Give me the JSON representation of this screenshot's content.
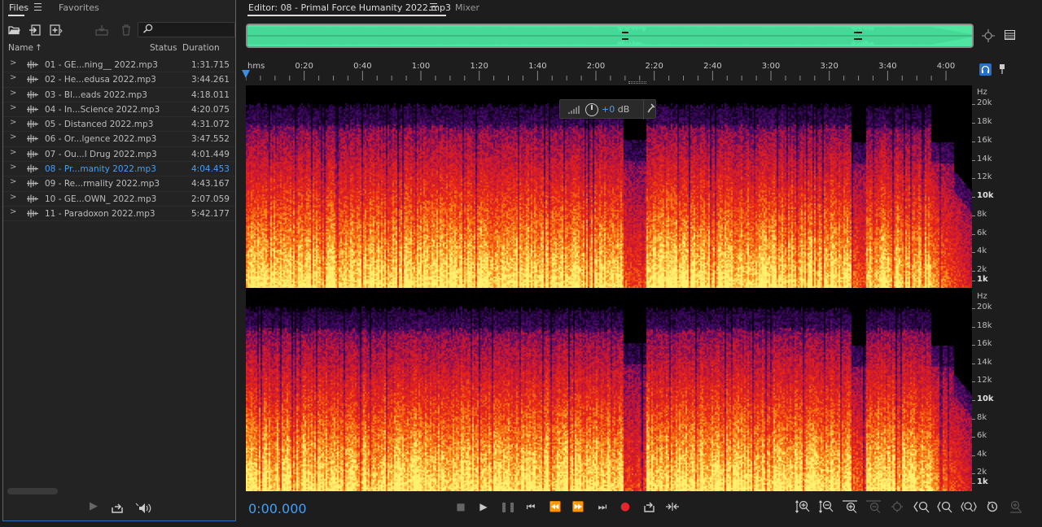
{
  "files_panel": {
    "tabs": [
      {
        "label": "Files",
        "active": true
      },
      {
        "label": "Favorites",
        "active": false
      }
    ],
    "toolbar_icons": [
      "open-folder-icon",
      "import-icon",
      "new-file-icon",
      "insert-icon",
      "trash-icon"
    ],
    "search_placeholder": "",
    "columns": {
      "name": "Name",
      "status": "Status",
      "duration": "Duration"
    },
    "sort_indicator": "↑",
    "files": [
      {
        "name": "01 - GE...ning__ 2022.mp3",
        "duration": "1:31.715",
        "selected": false
      },
      {
        "name": "02 - He...edusa 2022.mp3",
        "duration": "3:44.261",
        "selected": false
      },
      {
        "name": "03 - Bl...eads 2022.mp3",
        "duration": "4:18.011",
        "selected": false
      },
      {
        "name": "04 - In...Science 2022.mp3",
        "duration": "4:20.075",
        "selected": false
      },
      {
        "name": "05 - Distanced 2022.mp3",
        "duration": "4:31.072",
        "selected": false
      },
      {
        "name": "06 - Or...lgence 2022.mp3",
        "duration": "3:47.552",
        "selected": false
      },
      {
        "name": "07 - Ou...l Drug 2022.mp3",
        "duration": "4:01.449",
        "selected": false
      },
      {
        "name": "08 - Pr...manity 2022.mp3",
        "duration": "4:04.453",
        "selected": true
      },
      {
        "name": "09 - Re...rmality 2022.mp3",
        "duration": "4:43.167",
        "selected": false
      },
      {
        "name": "10 - GE...OWN_ 2022.mp3",
        "duration": "2:07.059",
        "selected": false
      },
      {
        "name": "11 - Paradoxon 2022.mp3",
        "duration": "5:42.177",
        "selected": false
      }
    ],
    "bottom_icons": [
      "play-icon",
      "loop-export-icon",
      "autoplay-icon"
    ]
  },
  "editor": {
    "tabs": [
      {
        "label": "Editor: 08 - Primal Force Humanity 2022.mp3",
        "active": true
      },
      {
        "label": "Mixer",
        "active": false
      }
    ],
    "ruler": {
      "unit": "hms",
      "labels": [
        "0:20",
        "0:40",
        "1:00",
        "1:20",
        "1:40",
        "2:00",
        "2:20",
        "2:40",
        "3:00",
        "3:20",
        "3:40",
        "4:00"
      ],
      "label_seconds": [
        20,
        40,
        60,
        80,
        100,
        120,
        140,
        160,
        180,
        200,
        220,
        240
      ],
      "range_seconds": [
        0,
        244.453
      ]
    },
    "hud": {
      "value": "+0",
      "unit": "dB"
    },
    "hz_scale": {
      "unit": "Hz",
      "labels": [
        "20k",
        "18k",
        "16k",
        "14k",
        "12k",
        "10k",
        "8k",
        "6k",
        "4k",
        "2k",
        "1k"
      ],
      "label_hz": [
        20000,
        18000,
        16000,
        14000,
        12000,
        10000,
        8000,
        6000,
        4000,
        2000,
        1000
      ],
      "bold": [
        "10k",
        "1k"
      ],
      "range_hz": [
        0,
        22050
      ]
    },
    "channels": 2,
    "timecode": "0:00.000",
    "transport_icons": [
      "stop-icon",
      "play-icon",
      "pause-icon",
      "move-to-previous-icon",
      "rewind-icon",
      "fast-forward-icon",
      "move-to-next-icon",
      "record-icon",
      "loop-playback-icon",
      "skip-selection-icon"
    ],
    "zoom_icons": [
      "zoom-in-amplitude-icon",
      "zoom-out-amplitude-icon",
      "zoom-in-frequency-icon",
      "zoom-out-frequency-icon",
      "zoom-reset-icon",
      "zoom-in-left-icon",
      "zoom-in-icon",
      "zoom-out-full-icon",
      "zoom-in-point-icon",
      "zoom-selection-icon"
    ],
    "colors": {
      "accent": "#4a9df0",
      "overview": "#4fe6a2",
      "record": "#e6262f",
      "panel_border": "#2d6fb8"
    }
  }
}
